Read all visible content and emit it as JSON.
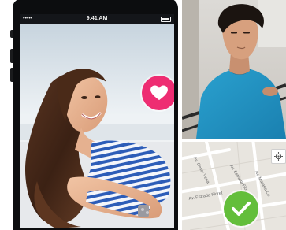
{
  "status_bar": {
    "signal": "••••• ",
    "time": "9:41 AM"
  },
  "icons": {
    "like": "heart-icon",
    "match": "checkmark-icon",
    "locate": "locate-target-icon"
  },
  "colors": {
    "like_button": "#ee2d72",
    "match_badge": "#63be3b",
    "phone_frame": "#0c0d0f"
  },
  "map": {
    "streets": [
      "Av. Estrada Eloy",
      "Av. Marana Co",
      "Av. Cesar Vena",
      "Av. Estrada Floret"
    ]
  }
}
